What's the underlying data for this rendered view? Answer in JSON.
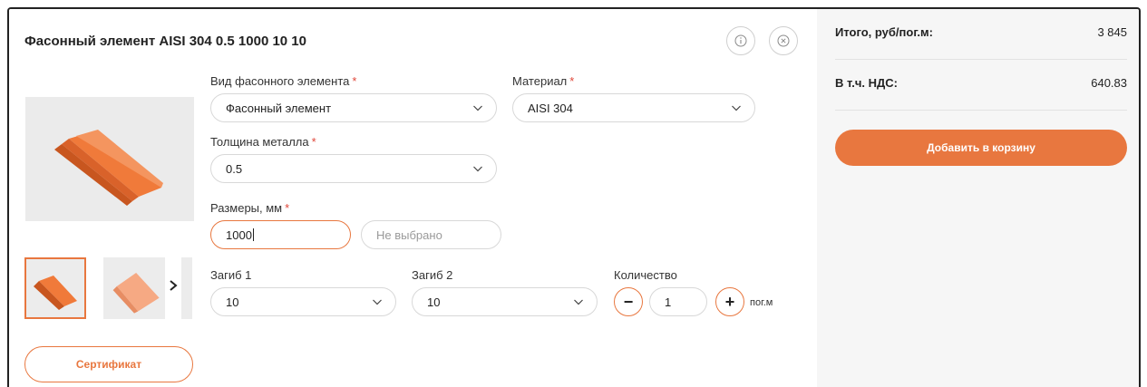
{
  "product": {
    "title": "Фасонный элемент AISI 304 0.5 1000 10 10"
  },
  "fields": {
    "type": {
      "label": "Вид фасонного элемента",
      "required": "*",
      "value": "Фасонный элемент"
    },
    "material": {
      "label": "Материал",
      "required": "*",
      "value": "AISI 304"
    },
    "thickness": {
      "label": "Толщина металла",
      "required": "*",
      "value": "0.5"
    },
    "sizes": {
      "label": "Размеры, мм",
      "required": "*",
      "value": "1000",
      "second_placeholder": "Не выбрано"
    },
    "bend1": {
      "label": "Загиб 1",
      "value": "10"
    },
    "bend2": {
      "label": "Загиб 2",
      "value": "10"
    },
    "quantity": {
      "label": "Количество",
      "value": "1",
      "minus": "−",
      "plus": "+",
      "unit": "пог.м"
    }
  },
  "actions": {
    "certificate": "Сертификат",
    "add_to_cart": "Добавить в корзину"
  },
  "summary": {
    "total_label": "Итого, руб/пог.м:",
    "total_value": "3 845",
    "vat_label": "В т.ч. НДС:",
    "vat_value": "640.83"
  },
  "colors": {
    "accent": "#e8773f",
    "product": "#f07a3a",
    "required": "#e0473a",
    "side_bg": "#f6f6f6"
  },
  "icons": [
    "info-icon",
    "close-icon",
    "chevron-down-icon",
    "chevron-right-icon"
  ]
}
